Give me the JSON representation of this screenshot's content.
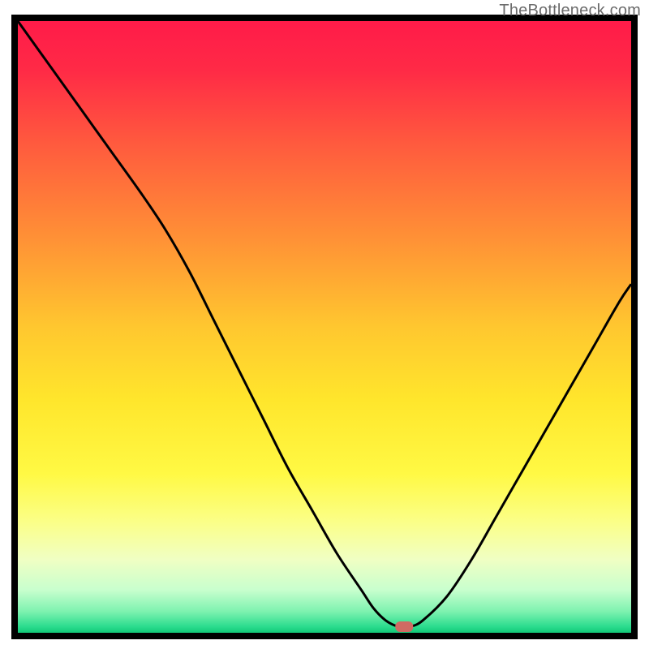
{
  "watermark": "TheBottleneck.com",
  "chart_data": {
    "type": "line",
    "title": "",
    "xlabel": "",
    "ylabel": "",
    "xlim": [
      0,
      100
    ],
    "ylim": [
      0,
      100
    ],
    "x": [
      0,
      5,
      10,
      15,
      20,
      24,
      28,
      32,
      36,
      40,
      44,
      48,
      52,
      56,
      58,
      60,
      62,
      63,
      64,
      66,
      70,
      74,
      78,
      82,
      86,
      90,
      94,
      98,
      100
    ],
    "y": [
      100,
      93,
      86,
      79,
      72,
      66,
      59,
      51,
      43,
      35,
      27,
      20,
      13,
      7,
      4,
      2,
      1,
      1,
      1,
      2,
      6,
      12,
      19,
      26,
      33,
      40,
      47,
      54,
      57
    ],
    "marker": {
      "x": 63,
      "y": 1,
      "color": "#d06a63"
    },
    "gradient_stops": [
      {
        "offset": 0.0,
        "color": "#ff1b49"
      },
      {
        "offset": 0.08,
        "color": "#ff2a46"
      },
      {
        "offset": 0.2,
        "color": "#ff5a3e"
      },
      {
        "offset": 0.35,
        "color": "#ff8f36"
      },
      {
        "offset": 0.5,
        "color": "#ffc72f"
      },
      {
        "offset": 0.62,
        "color": "#ffe62c"
      },
      {
        "offset": 0.74,
        "color": "#fff944"
      },
      {
        "offset": 0.82,
        "color": "#fbff89"
      },
      {
        "offset": 0.88,
        "color": "#f0ffc3"
      },
      {
        "offset": 0.93,
        "color": "#c8ffce"
      },
      {
        "offset": 0.965,
        "color": "#7ef2b0"
      },
      {
        "offset": 0.99,
        "color": "#2bdc8e"
      },
      {
        "offset": 1.0,
        "color": "#12c878"
      }
    ],
    "frame_color": "#000000"
  }
}
